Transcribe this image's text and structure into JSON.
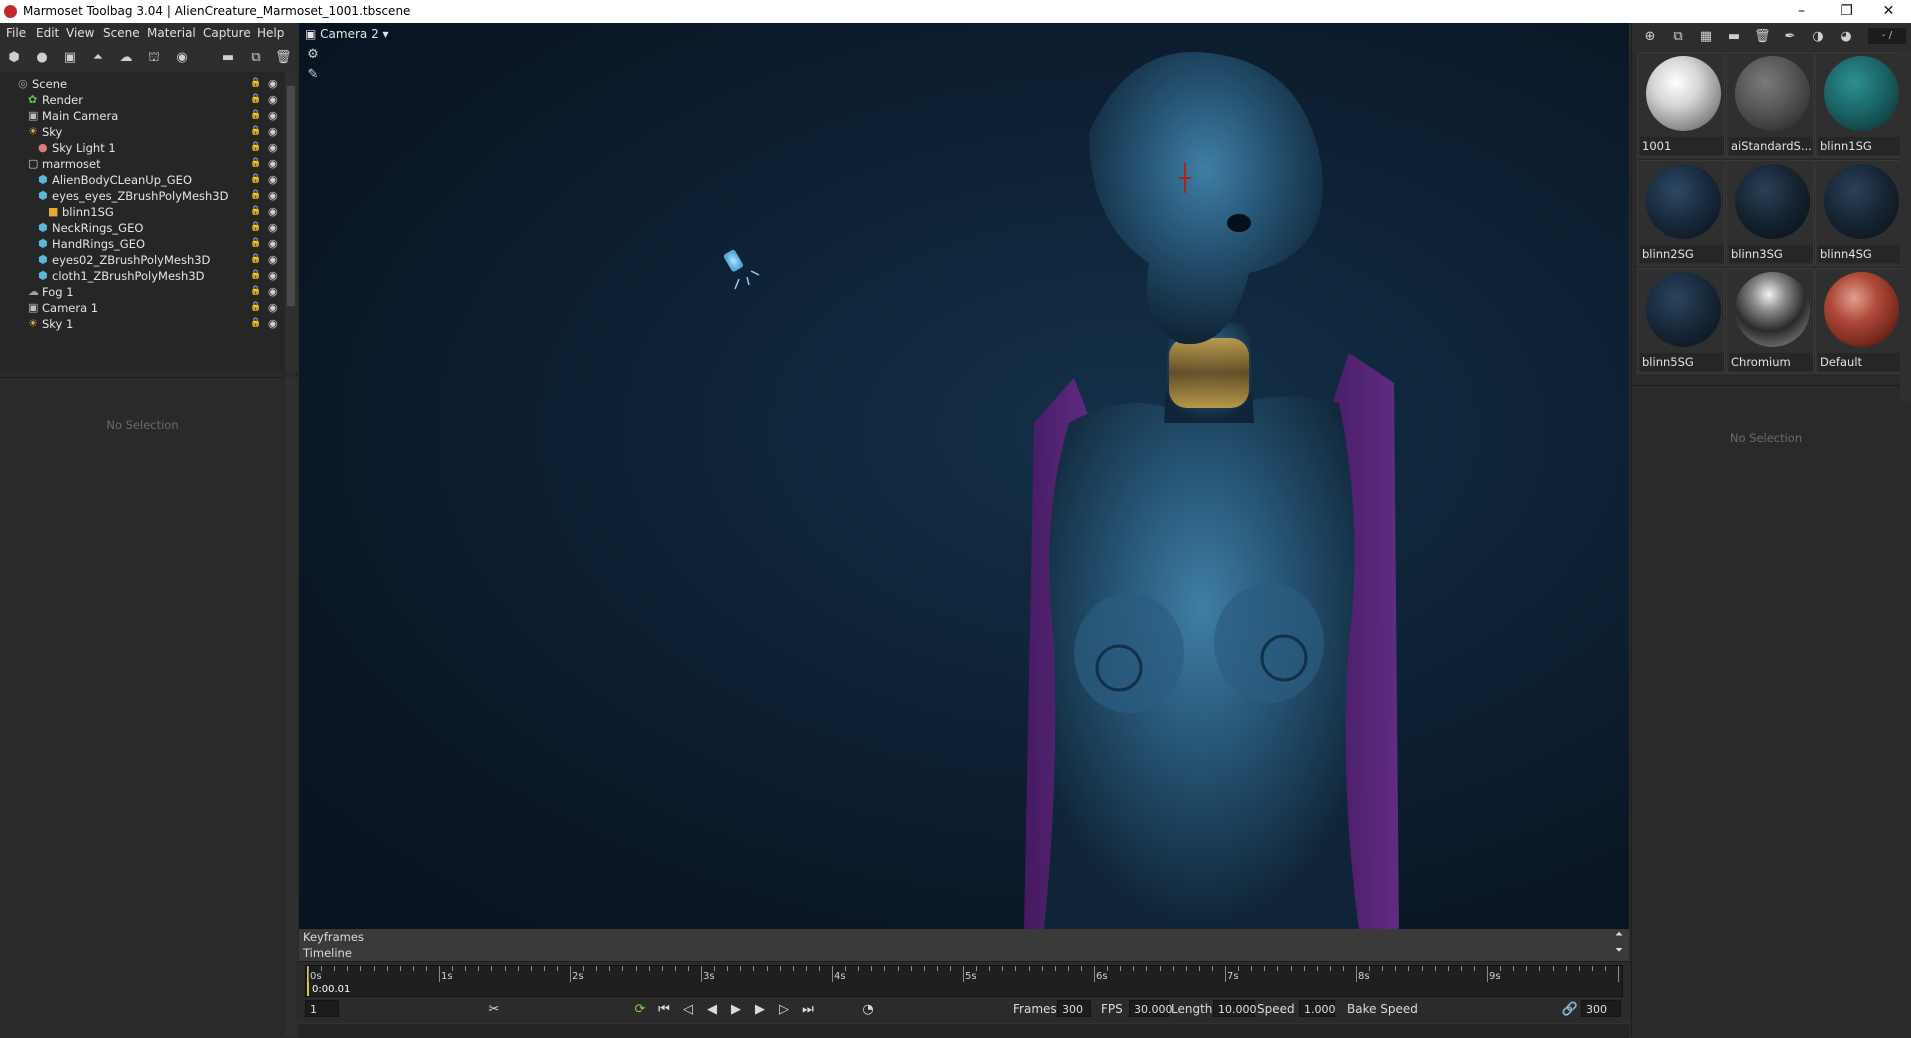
{
  "window": {
    "title": "Marmoset Toolbag 3.04  |  AlienCreature_Marmoset_1001.tbscene",
    "controls": [
      "–",
      "❐",
      "✕"
    ]
  },
  "menu": [
    "File",
    "Edit",
    "View",
    "Scene",
    "Material",
    "Capture",
    "Help"
  ],
  "scene_tree": {
    "rows": [
      {
        "label": "Scene",
        "icon": "scene-icon",
        "depth": 0,
        "color": "#9aa4ad"
      },
      {
        "label": "Render",
        "icon": "render-icon",
        "depth": 1,
        "color": "#6bbf59"
      },
      {
        "label": "Main Camera",
        "icon": "camera-icon",
        "depth": 1,
        "color": "#bfbfbf"
      },
      {
        "label": "Sky",
        "icon": "sky-icon",
        "depth": 1,
        "color": "#e6b84a"
      },
      {
        "label": "Sky Light 1",
        "icon": "light-icon",
        "depth": 2,
        "color": "#e07a7a"
      },
      {
        "label": "marmoset",
        "icon": "group-icon",
        "depth": 1,
        "color": "#cfcfcf"
      },
      {
        "label": "AlienBodyCLeanUp_GEO",
        "icon": "mesh-icon",
        "depth": 2,
        "color": "#5bb7d6"
      },
      {
        "label": "eyes_eyes_ZBrushPolyMesh3D",
        "icon": "mesh-icon",
        "depth": 2,
        "color": "#5bb7d6"
      },
      {
        "label": "blinn1SG",
        "icon": "material-icon",
        "depth": 3,
        "color": "#e8a93a"
      },
      {
        "label": "NeckRings_GEO",
        "icon": "mesh-icon",
        "depth": 2,
        "color": "#5bb7d6"
      },
      {
        "label": "HandRings_GEO",
        "icon": "mesh-icon",
        "depth": 2,
        "color": "#5bb7d6"
      },
      {
        "label": "eyes02_ZBrushPolyMesh3D",
        "icon": "mesh-icon",
        "depth": 2,
        "color": "#5bb7d6"
      },
      {
        "label": "cloth1_ZBrushPolyMesh3D",
        "icon": "mesh-icon",
        "depth": 2,
        "color": "#5bb7d6"
      },
      {
        "label": "Fog 1",
        "icon": "fog-icon",
        "depth": 1,
        "color": "#9aa4ad"
      },
      {
        "label": "Camera 1",
        "icon": "camera-icon",
        "depth": 1,
        "color": "#bfbfbf"
      },
      {
        "label": "Sky 1",
        "icon": "sky-icon",
        "depth": 1,
        "color": "#e6b84a"
      }
    ]
  },
  "left_properties": {
    "empty_text": "No Selection"
  },
  "viewport": {
    "camera_label": "Camera 2 ▾"
  },
  "timeline": {
    "keyframes_label": "Keyframes",
    "timeline_label": "Timeline",
    "seconds": [
      "0s",
      "1s",
      "2s",
      "3s",
      "4s",
      "5s",
      "6s",
      "7s",
      "8s",
      "9s"
    ],
    "current_time": "0:00.01",
    "current_frame": "1",
    "frames_label": "Frames",
    "frames_value": "300",
    "fps_label": "FPS",
    "fps_value": "30.000",
    "length_label": "Length",
    "length_value": "10.000",
    "speed_label": "Speed",
    "speed_value": "1.000",
    "bake_label": "Bake Speed",
    "end_frame": "300"
  },
  "materials": {
    "page": "- /",
    "items": [
      {
        "label": "1001",
        "sphere": "radial-gradient(circle at 40% 35%, #ffffff 0%, #d6d6d6 35%, #8d8d8d 70%, #4a4a4a 100%)"
      },
      {
        "label": "aiStandardS...",
        "sphere": "radial-gradient(circle at 40% 35%, #7a7a7a 0%, #555 45%, #333 80%, #222 100%)"
      },
      {
        "label": "blinn1SG",
        "sphere": "radial-gradient(circle at 40% 35%, #2c8f92 0%, #1b6668 45%, #0f3a3c 85%, #0a2526 100%)"
      },
      {
        "label": "blinn2SG",
        "sphere": "radial-gradient(circle at 40% 35%, #2d4a66 0%, #18283a 50%, #0c1622 90%)"
      },
      {
        "label": "blinn3SG",
        "sphere": "radial-gradient(circle at 40% 35%, #2a4058 0%, #15222f 50%, #0a121a 90%)"
      },
      {
        "label": "blinn4SG",
        "sphere": "radial-gradient(circle at 40% 35%, #2a4258 0%, #162432 50%, #0b141c 90%)"
      },
      {
        "label": "blinn5SG",
        "sphere": "radial-gradient(circle at 40% 35%, #2a4560 0%, #172738 50%, #0c1520 90%)"
      },
      {
        "label": "Chromium",
        "sphere": "radial-gradient(circle at 45% 30%, #f2f2f2 0%, #8a8a8a 25%, #2a2a2a 55%, #6a6a6a 80%, #1a1a1a 100%)"
      },
      {
        "label": "Default",
        "sphere": "radial-gradient(circle at 40% 35%, #e0a090 0%, #b04a3a 35%, #6e2418 75%, #3a120c 100%)"
      }
    ]
  },
  "right_properties": {
    "empty_text": "No Selection"
  }
}
